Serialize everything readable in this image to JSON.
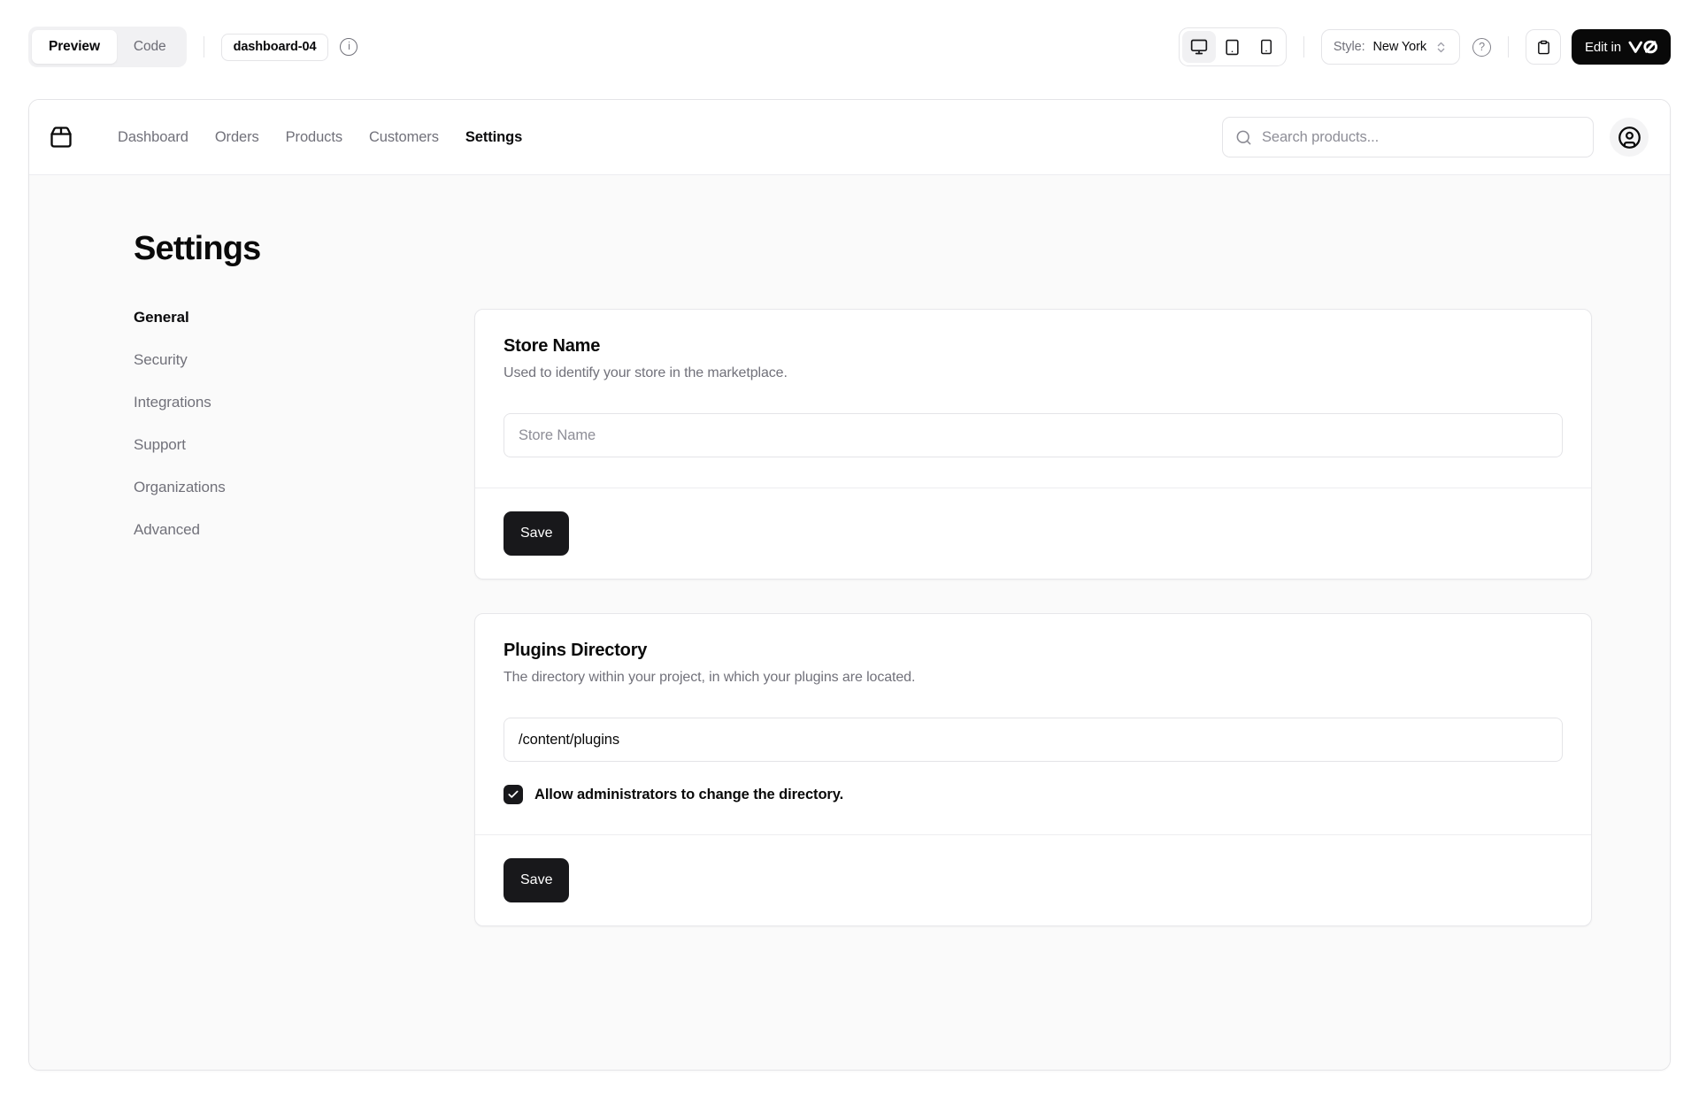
{
  "toolbar": {
    "preview_tab": "Preview",
    "code_tab": "Code",
    "block_badge": "dashboard-04",
    "style_label": "Style:",
    "style_value": "New York",
    "edit_label": "Edit in",
    "icons": {
      "info": "i",
      "help": "?",
      "edit_logo": "v0"
    }
  },
  "nav": {
    "links": [
      "Dashboard",
      "Orders",
      "Products",
      "Customers",
      "Settings"
    ],
    "active_link": "Settings",
    "search_placeholder": "Search products..."
  },
  "page": {
    "title": "Settings",
    "sidebar": [
      "General",
      "Security",
      "Integrations",
      "Support",
      "Organizations",
      "Advanced"
    ],
    "active_sidebar": "General",
    "cards": [
      {
        "title": "Store Name",
        "description": "Used to identify your store in the marketplace.",
        "input_placeholder": "Store Name",
        "input_value": "",
        "button": "Save"
      },
      {
        "title": "Plugins Directory",
        "description": "The directory within your project, in which your plugins are located.",
        "input_value": "/content/plugins",
        "checkbox_checked": true,
        "checkbox_label": "Allow administrators to change the directory.",
        "button": "Save"
      }
    ]
  },
  "colors": {
    "primary": "#18181b",
    "muted_text": "#71717a",
    "border": "#e4e4e7",
    "content_bg": "#fafafa"
  }
}
